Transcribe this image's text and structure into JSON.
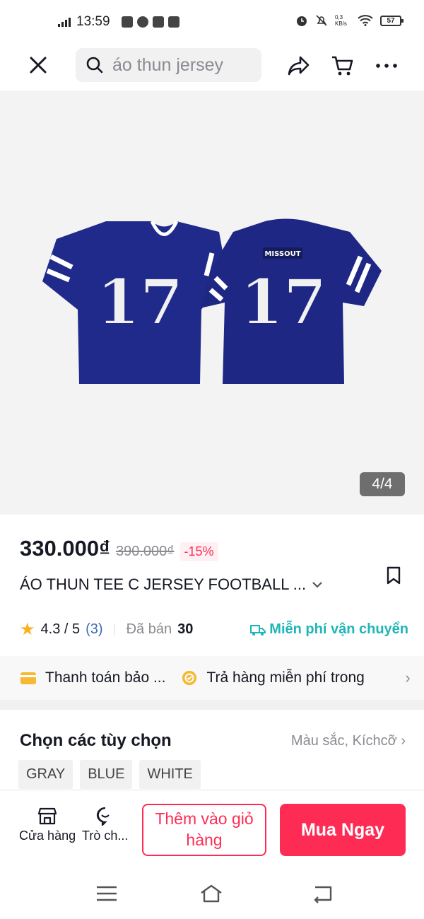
{
  "status_bar": {
    "time": "13:59",
    "net_speed": "0,3\nKB/s",
    "battery": "57"
  },
  "search": {
    "query": "áo thun jersey"
  },
  "gallery": {
    "counter": "4/4",
    "jersey_number": "17",
    "brand_patch": "MISSOUT"
  },
  "product": {
    "price": "330.000₫",
    "old_price": "390.000₫",
    "discount": "-15%",
    "title": "ÁO THUN TEE C JERSEY FOOTBALL ..."
  },
  "rating": {
    "score": "4.3 / 5",
    "count": "(3)",
    "sold_label": "Đã bán",
    "sold": "30",
    "free_shipping": "Miễn phí vận chuyển"
  },
  "benefits": [
    {
      "label": "Thanh toán bảo ...",
      "icon": "card-icon"
    },
    {
      "label": "Trả hàng miễn phí trong",
      "icon": "return-icon"
    }
  ],
  "options": {
    "title": "Chọn các tùy chọn",
    "summary": "Màu sắc, Kíchcỡ",
    "chips": [
      "GRAY",
      "BLUE",
      "WHITE"
    ]
  },
  "bottom_bar": {
    "shop_label": "Cửa hàng",
    "chat_label": "Trò ch...",
    "add_to_cart": "Thêm vào giỏ hàng",
    "buy_now": "Mua Ngay"
  },
  "colors": {
    "accent": "#fe2c55",
    "shipping": "#20b5b8",
    "jersey": "#1f2a8a",
    "star": "#fdb022"
  }
}
